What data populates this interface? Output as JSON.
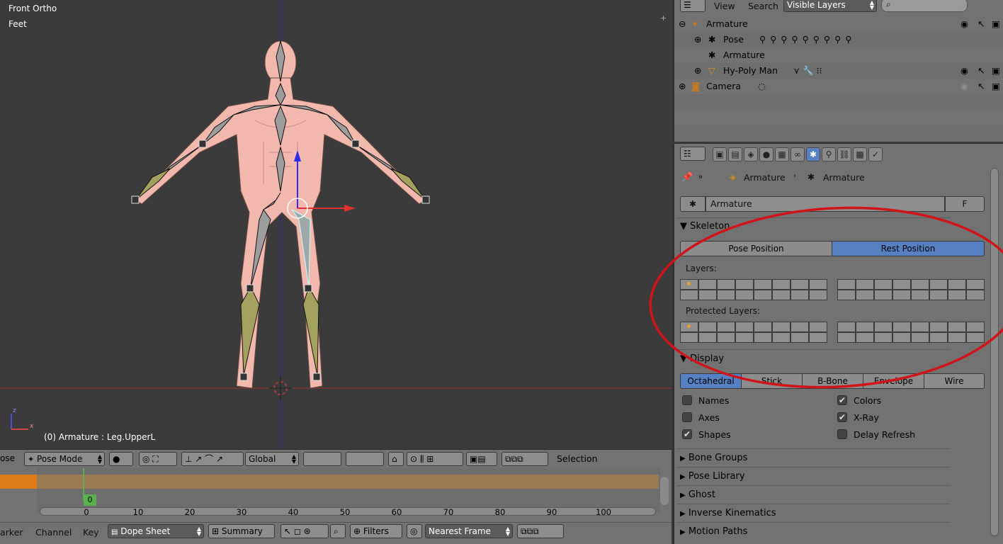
{
  "viewport": {
    "view_name": "Front Ortho",
    "units": "Feet",
    "status": "(0) Armature : Leg.UpperL"
  },
  "vp_header": {
    "mode_fragment": "ose",
    "mode": "Pose Mode",
    "orientation": "Global",
    "selection_label": "Selection"
  },
  "timeline": {
    "current_frame": "0",
    "ticks": [
      "0",
      "10",
      "20",
      "30",
      "40",
      "50",
      "60",
      "70",
      "80",
      "90",
      "100"
    ]
  },
  "tl_header": {
    "marker_fragment": "arker",
    "channel": "Channel",
    "key": "Key",
    "editor": "Dope Sheet",
    "summary": "Summary",
    "filters": "Filters",
    "snap": "Nearest Frame"
  },
  "outliner": {
    "view": "View",
    "search": "Search",
    "display_mode": "Visible Layers",
    "rows": [
      {
        "label": "Armature"
      },
      {
        "label": "Pose"
      },
      {
        "label": "Armature"
      },
      {
        "label": "Hy-Poly Man"
      },
      {
        "label": "Camera"
      }
    ]
  },
  "props": {
    "breadcrumb": [
      "Armature",
      "Armature"
    ],
    "datablock_name": "Armature",
    "fake_user": "F",
    "skeleton": {
      "title": "Skeleton",
      "pose_position": "Pose Position",
      "rest_position": "Rest Position",
      "layers_label": "Layers:",
      "protected_layers_label": "Protected Layers:"
    },
    "display": {
      "title": "Display",
      "types": [
        "Octahedral",
        "Stick",
        "B-Bone",
        "Envelope",
        "Wire"
      ],
      "selected_type": "Octahedral",
      "checks": [
        {
          "label": "Names",
          "checked": false
        },
        {
          "label": "Colors",
          "checked": true
        },
        {
          "label": "Axes",
          "checked": false
        },
        {
          "label": "X-Ray",
          "checked": true
        },
        {
          "label": "Shapes",
          "checked": true
        },
        {
          "label": "Delay Refresh",
          "checked": false
        }
      ]
    },
    "collapsed_panels": [
      "Bone Groups",
      "Pose Library",
      "Ghost",
      "Inverse Kinematics",
      "Motion Paths"
    ]
  },
  "colors": {
    "selected_blue": "#5680c2",
    "annotation_red": "#d0141a",
    "timeline_orange": "#e07b1a",
    "frame_green": "#5ab04e"
  }
}
